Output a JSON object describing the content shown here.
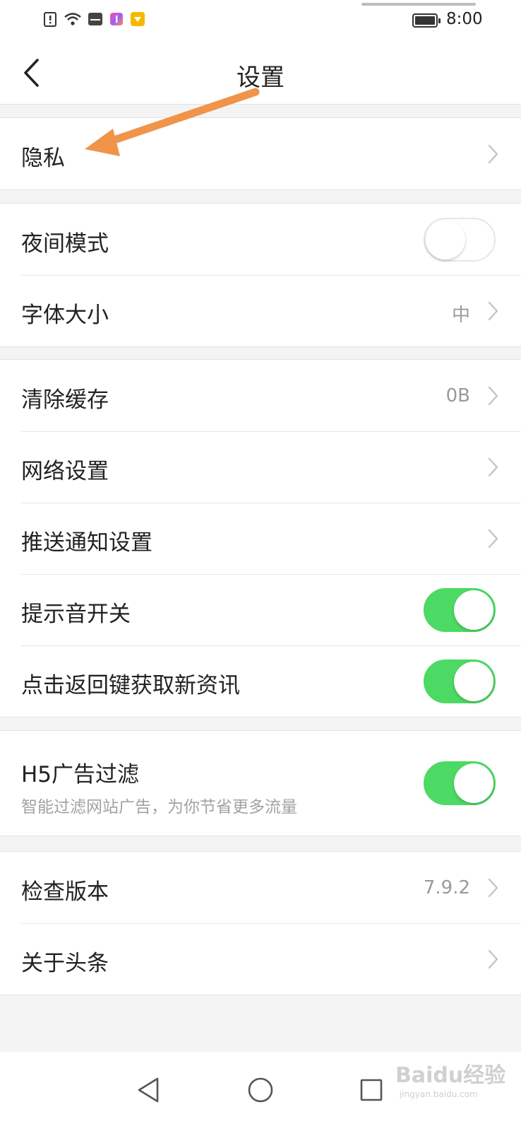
{
  "status_bar": {
    "time": "8:00",
    "icons": [
      "alert-sim-icon",
      "wifi-icon",
      "huawei-app-icon",
      "colorful-app-icon",
      "yellow-app-icon"
    ],
    "battery": "battery-full-icon"
  },
  "header": {
    "title": "设置",
    "back_icon": "chevron-left-icon"
  },
  "groups": [
    {
      "items": [
        {
          "label": "隐私",
          "control": "chevron"
        }
      ]
    },
    {
      "items": [
        {
          "label": "夜间模式",
          "control": "toggle",
          "on": false
        },
        {
          "label": "字体大小",
          "value": "中",
          "control": "chevron"
        }
      ]
    },
    {
      "items": [
        {
          "label": "清除缓存",
          "value": "0B",
          "control": "chevron"
        },
        {
          "label": "网络设置",
          "control": "chevron"
        },
        {
          "label": "推送通知设置",
          "control": "chevron"
        },
        {
          "label": "提示音开关",
          "control": "toggle",
          "on": true
        },
        {
          "label": "点击返回键获取新资讯",
          "control": "toggle",
          "on": true
        }
      ]
    },
    {
      "items": [
        {
          "label": "H5广告过滤",
          "sublabel": "智能过滤网站广告，为你节省更多流量",
          "control": "toggle",
          "on": true
        }
      ]
    },
    {
      "items": [
        {
          "label": "检查版本",
          "value": "7.9.2",
          "control": "chevron"
        },
        {
          "label": "关于头条",
          "control": "chevron"
        }
      ]
    }
  ],
  "annotation": {
    "arrow_color": "#f0944a"
  },
  "colors": {
    "toggle_on": "#4cd964",
    "background": "#f4f4f4"
  },
  "nav_bar": {
    "buttons": [
      "back-triangle-icon",
      "home-circle-icon",
      "recents-square-icon"
    ]
  },
  "watermark": {
    "text": "Baidu经验",
    "sub": "jingyan.baidu.com"
  }
}
